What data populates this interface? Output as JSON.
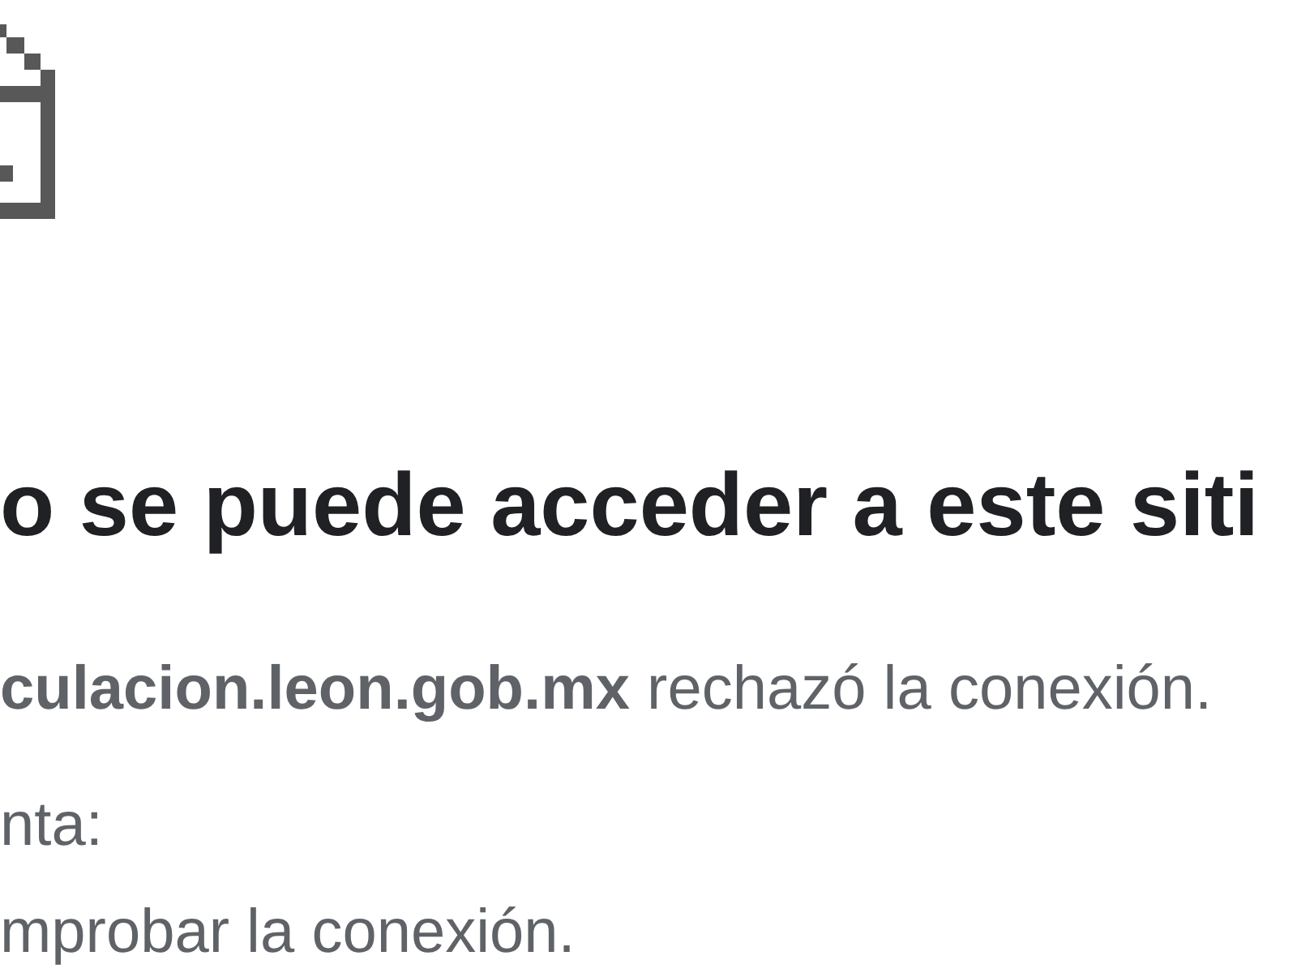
{
  "heading": "o se puede acceder a este siti",
  "message": "**culacion.leon.gob.mx** rechazó la conexión.",
  "suggestions_label": "nta:",
  "suggestions": [
    "mprobar la conexión."
  ]
}
